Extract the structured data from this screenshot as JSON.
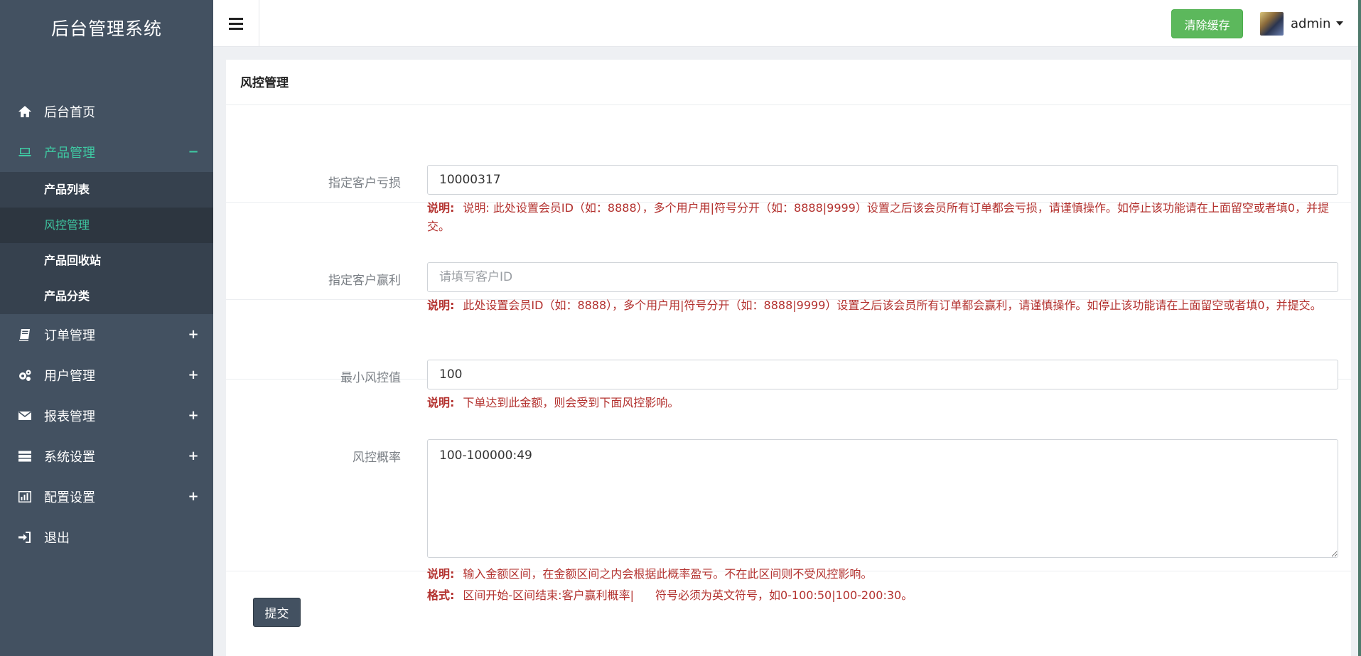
{
  "brand": "后台管理系统",
  "nav": {
    "home": "后台首页",
    "product": "产品管理",
    "product_toggle": "−",
    "sub": [
      "产品列表",
      "风控管理",
      "产品回收站",
      "产品分类"
    ],
    "orders": "订单管理",
    "users": "用户管理",
    "reports": "报表管理",
    "system": "系统设置",
    "config": "配置设置",
    "logout": "退出",
    "expand_toggle": "+"
  },
  "topbar": {
    "clear_cache": "清除缓存",
    "username": "admin"
  },
  "panel": {
    "title": "风控管理",
    "loss": {
      "label": "指定客户亏损",
      "value": "10000317",
      "note_label": "说明:",
      "note_text": "说明:  此处设置会员ID（如：8888），多个用户用|符号分开（如：8888|9999）设置之后该会员所有订单都会亏损，请谨慎操作。如停止该功能请在上面留空或者填0，并提交。"
    },
    "win": {
      "label": "指定客户赢利",
      "placeholder": "请填写客户ID",
      "note_label": "说明:",
      "note_text": "此处设置会员ID（如：8888），多个用户用|符号分开（如：8888|9999）设置之后该会员所有订单都会赢利，请谨慎操作。如停止该功能请在上面留空或者填0，并提交。"
    },
    "min": {
      "label": "最小风控值",
      "value": "100",
      "note_label": "说明:",
      "note_text": "下单达到此金额，则会受到下面风控影响。"
    },
    "rate": {
      "label": "风控概率",
      "value": "100-100000:49",
      "note_label": "说明:",
      "note_text": "输入金额区间，在金额区间之内会根据此概率盈亏。不在此区间则不受风控影响。",
      "format_label": "格式:",
      "format_text": "区间开始-区间结束:客户赢利概率|",
      "format_text2": "符号必须为英文符号，如0-100:50|100-200:30。"
    },
    "submit": "提交"
  }
}
